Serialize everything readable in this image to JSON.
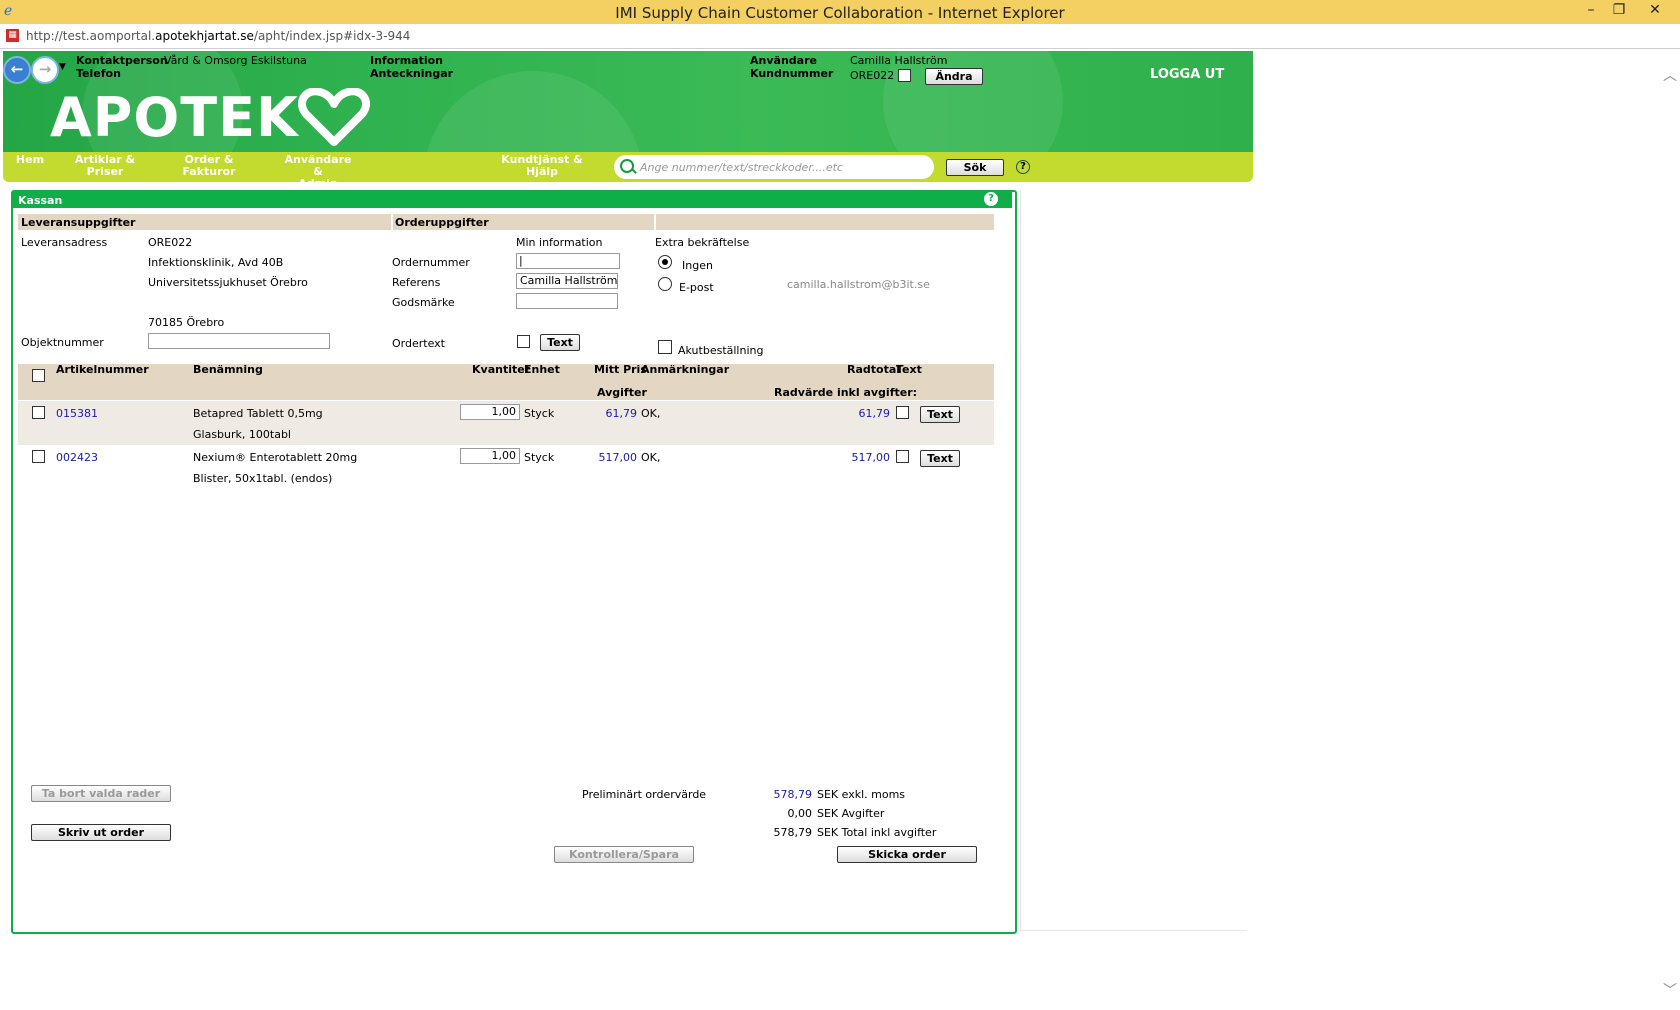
{
  "window": {
    "title": "IMI Supply Chain Customer Collaboration - Internet Explorer",
    "minimize": "–",
    "restore": "❐",
    "close": "✕"
  },
  "address": {
    "prefix": "http://test.aomportal.",
    "domain": "apotekhjartat.se",
    "path": "/apht/index.jsp#idx-3-944"
  },
  "header": {
    "kontaktperson_label": "Kontaktperson",
    "kontaktperson_value": "Vård & Omsorg Eskilstuna",
    "telefon_label": "Telefon",
    "information_label": "Information",
    "anteckningar_label": "Anteckningar",
    "anvandare_label": "Användare",
    "anvandare_value": "Camilla Hallström",
    "kundnummer_label": "Kundnummer",
    "kundnummer_value": "ORE022",
    "andra_button": "Ändra",
    "logout": "LOGGA UT",
    "logo": "APOTEK"
  },
  "menu": {
    "items": [
      {
        "line1": "Hem",
        "line2": ""
      },
      {
        "line1": "Artiklar &",
        "line2": "Priser"
      },
      {
        "line1": "Order &",
        "line2": "Fakturor"
      },
      {
        "line1": "Användare &",
        "line2": "Admin"
      },
      {
        "line1": "Kundtjänst &",
        "line2": "Hjälp"
      }
    ],
    "search_placeholder": "Ange nummer/text/streckkoder....etc",
    "search_button": "Sök",
    "help": "?"
  },
  "panel": {
    "title": "Kassan",
    "help": "?"
  },
  "delivery": {
    "section_title": "Leveransuppgifter",
    "address_label": "Leveransadress",
    "address_lines": [
      "ORE022",
      "Infektionsklinik, Avd 40B",
      "Universitetssjukhuset Örebro",
      "70185 Örebro"
    ],
    "objektnummer_label": "Objektnummer",
    "objektnummer_value": ""
  },
  "order": {
    "section_title": "Orderuppgifter",
    "min_information": "Min information",
    "ordernummer_label": "Ordernummer",
    "ordernummer_value": "|",
    "referens_label": "Referens",
    "referens_value": "Camilla  Hallström",
    "godsmarke_label": "Godsmärke",
    "godsmarke_value": "",
    "ordertext_label": "Ordertext",
    "ordertext_button": "Text",
    "extra_label": "Extra bekräftelse",
    "radio_ingen": "Ingen",
    "radio_epost": "E-post",
    "email": "camilla.hallstrom@b3it.se",
    "akut_label": "Akutbeställning"
  },
  "table": {
    "headers": {
      "artikelnummer": "Artikelnummer",
      "benamning": "Benämning",
      "kvantitet": "Kvantitet",
      "enhet": "Enhet",
      "mitt_pris": "Mitt Pris",
      "anmarkningar": "Anmärkningar",
      "radtotal": "Radtotal",
      "text": "Text",
      "avgifter": "Avgifter",
      "radvarde": "Radvärde inkl avgifter:"
    },
    "rows": [
      {
        "artikel": "015381",
        "namn": "Betapred Tablett 0,5mg",
        "namn2": "Glasburk, 100tabl",
        "kvantitet": "1,00",
        "enhet": "Styck",
        "pris": "61,79",
        "anm": "OK,",
        "radtotal": "61,79",
        "text_button": "Text"
      },
      {
        "artikel": "002423",
        "namn": "Nexium® Enterotablett 20mg",
        "namn2": "Blister, 50x1tabl. (endos)",
        "kvantitet": "1,00",
        "enhet": "Styck",
        "pris": "517,00",
        "anm": "OK,",
        "radtotal": "517,00",
        "text_button": "Text"
      }
    ]
  },
  "summary": {
    "remove_button": "Ta bort valda rader",
    "print_button": "Skriv ut order",
    "prelim_label": "Preliminärt ordervärde",
    "exkl_value": "578,79",
    "exkl_label": "SEK exkl. moms",
    "avgifter_value": "0,00",
    "avgifter_label": "SEK Avgifter",
    "total_value": "578,79",
    "total_label": "SEK Total inkl avgifter",
    "kontrollera_button": "Kontrollera/Spara",
    "skicka_button": "Skicka order"
  }
}
